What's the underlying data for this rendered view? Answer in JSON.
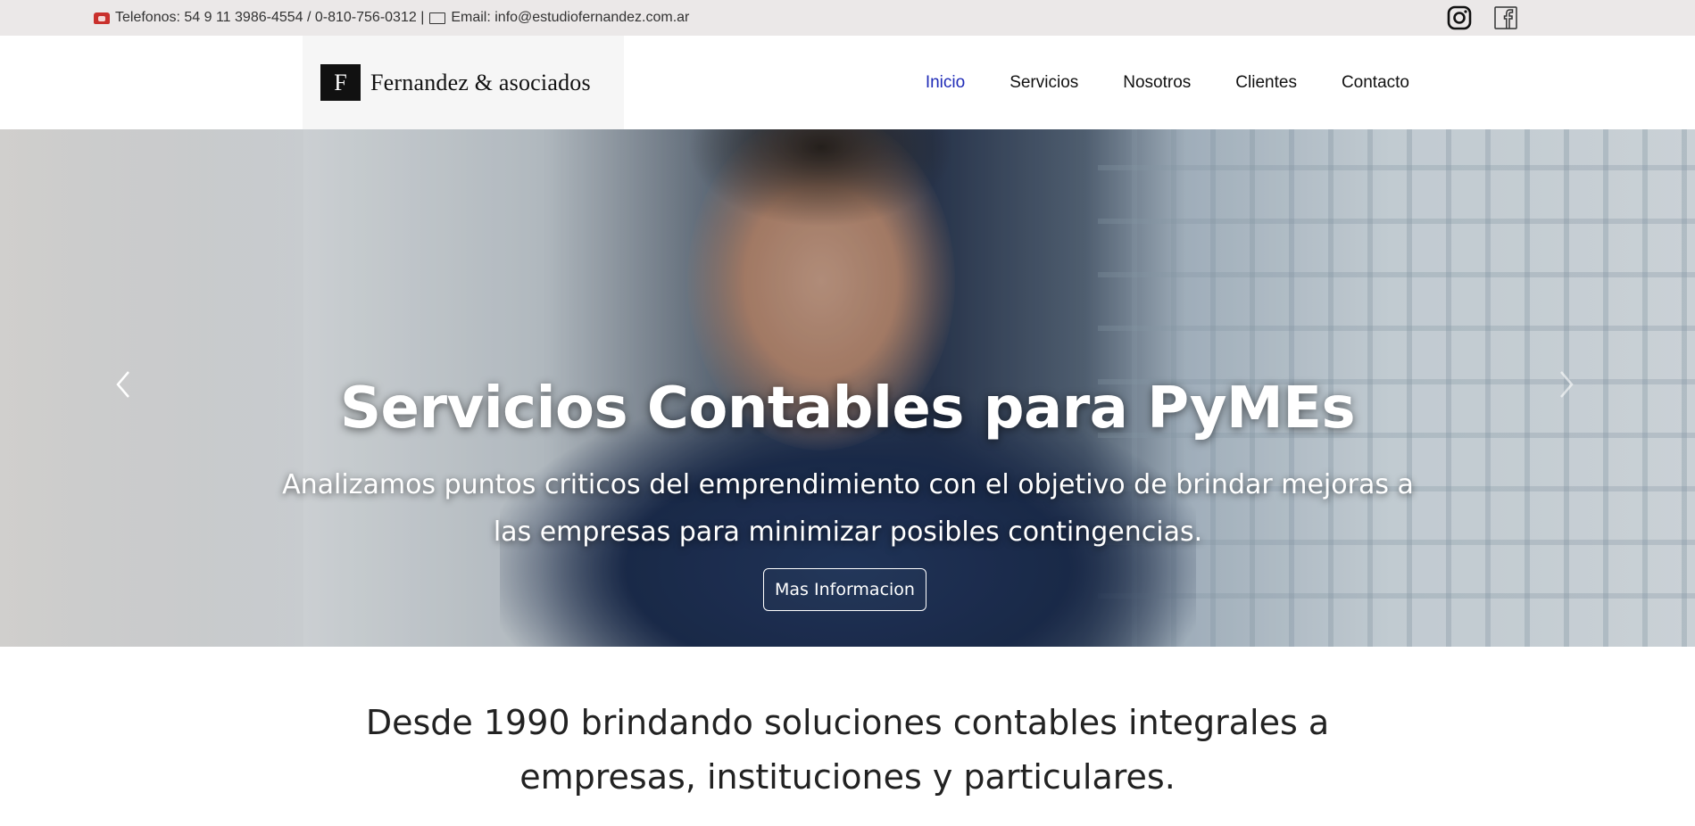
{
  "topbar": {
    "phone_icon": "phone-icon",
    "phones_text": "Telefonos: 54 9 11 3986-4554 / 0-810-756-0312 |",
    "mail_icon": "mail-icon",
    "email_text": "Email: info@estudiofernandez.com.ar",
    "social": [
      {
        "name": "instagram-icon"
      },
      {
        "name": "facebook-icon"
      }
    ]
  },
  "header": {
    "logo_letter": "F",
    "logo_text": "Fernandez & asociados",
    "nav": [
      {
        "label": "Inicio",
        "active": true
      },
      {
        "label": "Servicios",
        "active": false
      },
      {
        "label": "Nosotros",
        "active": false
      },
      {
        "label": "Clientes",
        "active": false
      },
      {
        "label": "Contacto",
        "active": false
      }
    ]
  },
  "hero": {
    "title": "Servicios Contables para PyMEs",
    "subtitle_line1": "Analizamos puntos criticos del emprendimiento con el objetivo de brindar mejoras a",
    "subtitle_line2": "las empresas para minimizar posibles contingencias.",
    "button_label": "Mas Informacion",
    "prev_icon": "chevron-left-icon",
    "next_icon": "chevron-right-icon"
  },
  "intro": {
    "line1": "Desde 1990 brindando soluciones contables integrales a",
    "line2": "empresas, instituciones y particulares."
  },
  "colors": {
    "topbar_bg": "#ebe8e8",
    "nav_active": "#1f2bb7",
    "logo_bg": "#f6f6f6"
  }
}
